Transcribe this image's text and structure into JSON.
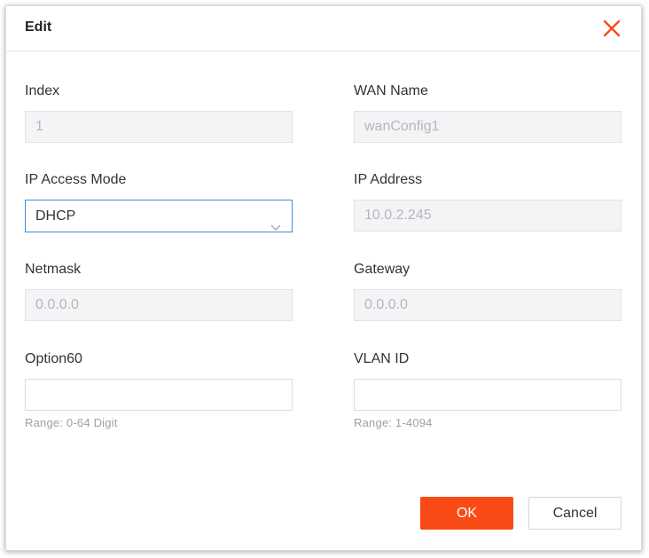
{
  "dialog": {
    "title": "Edit",
    "close_icon": "close-icon",
    "accent_color": "#fa4a18"
  },
  "fields": {
    "index": {
      "label": "Index",
      "value": "1"
    },
    "wan_name": {
      "label": "WAN Name",
      "value": "wanConfig1"
    },
    "ip_access_mode": {
      "label": "IP Access Mode",
      "value": "DHCP"
    },
    "ip_address": {
      "label": "IP Address",
      "value": "10.0.2.245"
    },
    "netmask": {
      "label": "Netmask",
      "value": "0.0.0.0"
    },
    "gateway": {
      "label": "Gateway",
      "value": "0.0.0.0"
    },
    "option60": {
      "label": "Option60",
      "value": "",
      "hint": "Range: 0-64 Digit"
    },
    "vlan_id": {
      "label": "VLAN ID",
      "value": "",
      "hint": "Range: 1-4094"
    }
  },
  "buttons": {
    "ok": "OK",
    "cancel": "Cancel"
  }
}
